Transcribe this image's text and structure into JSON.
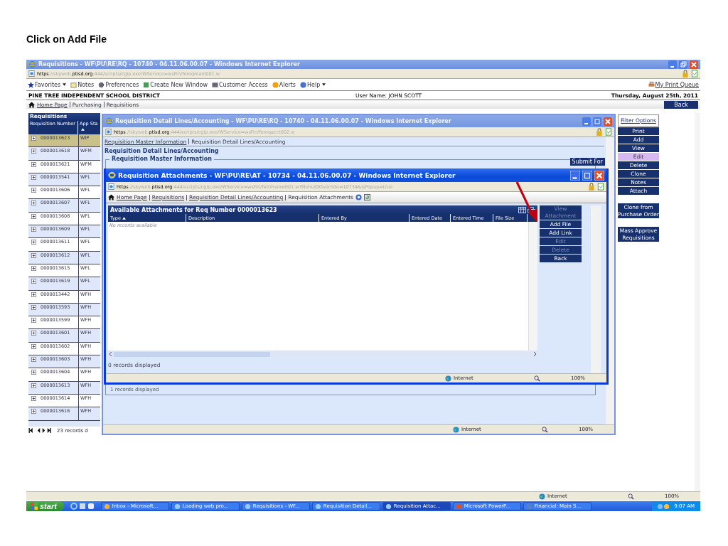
{
  "slide_title": "Click on Add File",
  "main_window": {
    "title": "Requisitions - WF\\PU\\RE\\RQ - 10740 - 04.11.06.00.07 - Windows Internet Explorer",
    "address": {
      "scheme": "https",
      "host_prefix": "://skyweb.",
      "host": "ptisd.org",
      "path": ":444/scripts/cgip.exe/WService=wsFin/foreqmain001.w"
    },
    "toolbar": [
      {
        "label": "Favorites",
        "dropdown": true
      },
      {
        "label": "Notes",
        "dropdown": false
      },
      {
        "label": "Preferences",
        "dropdown": false
      },
      {
        "label": "Create New Window",
        "dropdown": false
      },
      {
        "label": "Customer Access",
        "dropdown": false
      },
      {
        "label": "Alerts",
        "dropdown": false
      },
      {
        "label": "Help",
        "dropdown": true
      }
    ],
    "print_queue": "My Print Queue",
    "district": "PINE TREE INDEPENDENT SCHOOL DISTRICT",
    "user": "User Name: JOHN SCOTT",
    "date": "Thursday, August 25th, 2011",
    "breadcrumb": [
      {
        "label": "Home Page",
        "link": true
      },
      {
        "label": "Purchasing",
        "link": false
      },
      {
        "label": "Requisitions",
        "link": false
      }
    ],
    "back": "Back",
    "list": {
      "title": "Requisitions",
      "columns": [
        "Requisition Number",
        "App Sta"
      ],
      "rows": [
        {
          "number": "0000013623",
          "status": "WIP",
          "selected": true
        },
        {
          "number": "0000013618",
          "status": "WFM",
          "selected": false
        },
        {
          "number": "0000013621",
          "status": "WFM",
          "selected": false
        },
        {
          "number": "0000013541",
          "status": "WFL",
          "selected": false
        },
        {
          "number": "0000013606",
          "status": "WFL",
          "selected": false
        },
        {
          "number": "0000013607",
          "status": "WFL",
          "selected": false
        },
        {
          "number": "0000013608",
          "status": "WFL",
          "selected": false
        },
        {
          "number": "0000013609",
          "status": "WFL",
          "selected": false
        },
        {
          "number": "0000013611",
          "status": "WFL",
          "selected": false
        },
        {
          "number": "0000013612",
          "status": "WFL",
          "selected": false
        },
        {
          "number": "0000013615",
          "status": "WFL",
          "selected": false
        },
        {
          "number": "0000013619",
          "status": "WFL",
          "selected": false
        },
        {
          "number": "0000013442",
          "status": "WFH",
          "selected": false
        },
        {
          "number": "0000013593",
          "status": "WFH",
          "selected": false
        },
        {
          "number": "0000013599",
          "status": "WFH",
          "selected": false
        },
        {
          "number": "0000013601",
          "status": "WFH",
          "selected": false
        },
        {
          "number": "0000013602",
          "status": "WFH",
          "selected": false
        },
        {
          "number": "0000013603",
          "status": "WFH",
          "selected": false
        },
        {
          "number": "0000013604",
          "status": "WFH",
          "selected": false
        },
        {
          "number": "0000013613",
          "status": "WFH",
          "selected": false
        },
        {
          "number": "0000013614",
          "status": "WFH",
          "selected": false
        },
        {
          "number": "0000013616",
          "status": "WFH",
          "selected": false
        }
      ],
      "footer": "23 records d"
    },
    "actions": [
      {
        "label": "Filter Options",
        "kind": "filter",
        "highlighted": false
      },
      {
        "label": "Print",
        "kind": "button",
        "highlighted": false
      },
      {
        "label": "Add",
        "kind": "button",
        "highlighted": false
      },
      {
        "label": "View",
        "kind": "button",
        "highlighted": false
      },
      {
        "label": "Edit",
        "kind": "button",
        "highlighted": true
      },
      {
        "label": "Delete",
        "kind": "button",
        "highlighted": false
      },
      {
        "label": "Clone",
        "kind": "button",
        "highlighted": false
      },
      {
        "label": "Notes",
        "kind": "button",
        "highlighted": false
      },
      {
        "label": "Attach",
        "kind": "button",
        "highlighted": false
      },
      {
        "label": "Clone from Purchase Order",
        "kind": "wide",
        "highlighted": false
      },
      {
        "label": "Mass Approve Requisitions",
        "kind": "wide",
        "highlighted": false
      }
    ],
    "status": {
      "zone": "Internet",
      "zoom": "100%"
    }
  },
  "detail_window": {
    "title": "Requisition Detail Lines/Accounting - WF\\PU\\RE\\RQ - 10740 - 04.11.06.00.07 - Windows Internet Explorer",
    "address": {
      "scheme": "https",
      "host_prefix": "://skyweb.",
      "host": "ptisd.org",
      "path": ":444/scripts/cgip.exe/WService=wsFin/foreqacct002.w"
    },
    "links": [
      {
        "label": "Requisition Master Information",
        "link": true
      },
      {
        "label": "Requisition Detail Lines/Accounting",
        "link": false
      }
    ],
    "heading": "Requisition Detail Lines/Accounting",
    "legend": "Requisition Master Information",
    "submit": "Submit For",
    "footer": "1 records displayed",
    "status": {
      "zone": "Internet",
      "zoom": "100%"
    }
  },
  "attach_window": {
    "title": "Requisition Attachments - WF\\PU\\RE\\AT - 10734 - 04.11.06.00.07 - Windows Internet Explorer",
    "address": {
      "scheme": "https",
      "host_prefix": "://skyweb.",
      "host": "ptisd.org",
      "path": ":444/scripts/cgip.exe/WService=wsFin/fattmview001.w?MenuIDOverride=10734&isPopup=true"
    },
    "breadcrumb": [
      {
        "label": "Home Page",
        "link": true
      },
      {
        "label": "Requisitions",
        "link": true
      },
      {
        "label": "Requisition Detail Lines/Accounting",
        "link": true
      },
      {
        "label": "Requisition Attachments",
        "link": false
      }
    ],
    "grid_title": "Available Attachments for Req Number 0000013623",
    "columns": [
      "Type",
      "Description",
      "Entered By",
      "Entered Date",
      "Entered Time",
      "File Size"
    ],
    "empty": "No records available",
    "buttons": [
      {
        "label": "View Attachment",
        "disabled": true
      },
      {
        "label": "Add File",
        "disabled": false
      },
      {
        "label": "Add Link",
        "disabled": false
      },
      {
        "label": "Edit",
        "disabled": true
      },
      {
        "label": "Delete",
        "disabled": true
      },
      {
        "label": "Back",
        "disabled": false
      }
    ],
    "footer": "0 records displayed",
    "status": {
      "zone": "Internet",
      "zoom": "100%"
    }
  },
  "taskbar": {
    "start": "start",
    "tasks": [
      {
        "label": "Inbox - Microsoft...",
        "selected": false
      },
      {
        "label": "Loading web pro...",
        "selected": false
      },
      {
        "label": "Requisitions - WF...",
        "selected": false
      },
      {
        "label": "Requisition Detail...",
        "selected": false
      },
      {
        "label": "Requisition Attac...",
        "selected": true
      },
      {
        "label": "Microsoft PowerP...",
        "selected": false
      },
      {
        "label": "Financial: Main S...",
        "selected": false
      }
    ],
    "clock": "9:07 AM"
  }
}
